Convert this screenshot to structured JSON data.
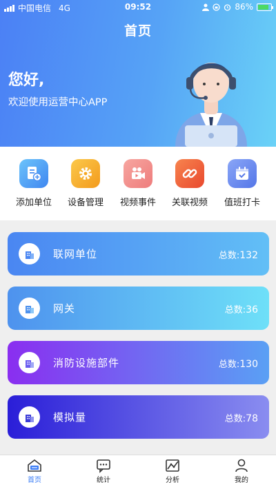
{
  "status_bar": {
    "carrier": "中国电信",
    "network": "4G",
    "time": "09:52",
    "battery": "86%"
  },
  "header": {
    "title": "首页",
    "greeting": "您好,",
    "welcome": "欢迎使用运营中心APP"
  },
  "quick_actions": [
    {
      "label": "添加单位",
      "icon": "add-unit-icon",
      "color": "#4fa0f7"
    },
    {
      "label": "设备管理",
      "icon": "gear-icon",
      "color": "#f6a722"
    },
    {
      "label": "视频事件",
      "icon": "video-camera-icon",
      "color": "#f08a8a"
    },
    {
      "label": "关联视频",
      "icon": "link-icon",
      "color": "#f0643f"
    },
    {
      "label": "值班打卡",
      "icon": "calendar-check-icon",
      "color": "#6e8cf0"
    }
  ],
  "stats_cards": [
    {
      "name": "联网单位",
      "total_label": "总数:",
      "total": "132",
      "gradient": [
        "#4a86f2",
        "#62bff6"
      ]
    },
    {
      "name": "网关",
      "total_label": "总数:",
      "total": "36",
      "gradient": [
        "#4e92ee",
        "#6ee0f8"
      ]
    },
    {
      "name": "消防设施部件",
      "total_label": "总数:",
      "total": "130",
      "gradient": [
        "#8a2ef0",
        "#5aa0f4"
      ]
    },
    {
      "name": "模拟量",
      "total_label": "总数:",
      "total": "78",
      "gradient": [
        "#2a1ed8",
        "#8a8df0"
      ]
    }
  ],
  "tabbar": [
    {
      "label": "首页",
      "icon": "home-icon",
      "active": true
    },
    {
      "label": "统计",
      "icon": "chat-stats-icon",
      "active": false
    },
    {
      "label": "分析",
      "icon": "analysis-chart-icon",
      "active": false
    },
    {
      "label": "我的",
      "icon": "user-icon",
      "active": false
    }
  ],
  "accent_color": "#3b7df6"
}
